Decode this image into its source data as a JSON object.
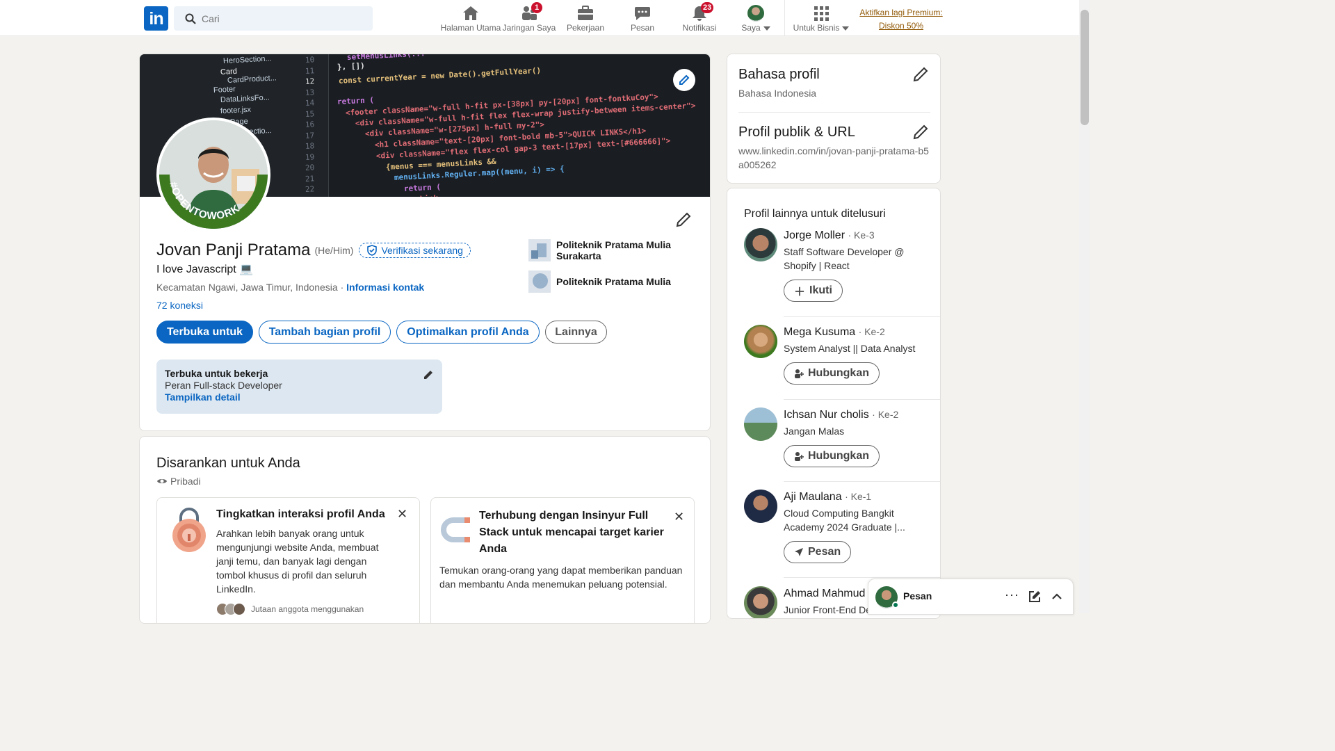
{
  "nav": {
    "search_placeholder": "Cari",
    "items": [
      {
        "label": "Halaman Utama",
        "icon": "home-icon"
      },
      {
        "label": "Jaringan Saya",
        "icon": "network-icon",
        "badge": "1"
      },
      {
        "label": "Pekerjaan",
        "icon": "briefcase-icon"
      },
      {
        "label": "Pesan",
        "icon": "message-icon"
      },
      {
        "label": "Notifikasi",
        "icon": "bell-icon",
        "badge": "23"
      },
      {
        "label": "Saya",
        "icon": "avatar"
      },
      {
        "label": "Untuk Bisnis",
        "icon": "grid-icon"
      }
    ],
    "premium_line1": "Aktifkan lagi Premium:",
    "premium_line2": "Diskon 50%"
  },
  "cover": {
    "tree": [
      "HeroSection...",
      "Card",
      "CardProduct...",
      "Footer",
      "DataLinksFo...",
      "footer.jsx",
      "Page",
      "Sectio..."
    ],
    "line_numbers": [
      "10",
      "11",
      "12",
      "13",
      "14",
      "15",
      "16",
      "17",
      "18",
      "19",
      "20",
      "21",
      "22"
    ],
    "code": [
      "setMenusLinks(...",
      "}, [])",
      "const currentYear = new Date().getFullYear()",
      "return (",
      "<footer className=\"w-full h-fit px-[38px] py-[20px] font-fontkuCoy\">",
      "<div className=\"w-full h-fit flex flex-wrap justify-between items-center\">",
      "<div className=\"w-[275px] h-full my-2\">",
      "<h1 className=\"text-[20px] font-bold mb-5\">QUICK LINKS</h1>",
      "<div className=\"flex flex-col gap-3 text-[17px] text-[#666666]\">",
      "{menus === menusLinks &&",
      "menusLinks.Reguler.map((menu, i) => {",
      "return (",
      "<Link"
    ],
    "otw_ring_text": "#OPENTOWORK"
  },
  "profile": {
    "name": "Jovan Panji Pratama",
    "pronoun": "(He/Him)",
    "verify_label": "Verifikasi sekarang",
    "headline": "I love Javascript 💻",
    "location": "Kecamatan Ngawi, Jawa Timur, Indonesia",
    "location_sep": " · ",
    "contact_info": "Informasi kontak",
    "connections": "72 koneksi",
    "buttons": [
      "Terbuka untuk",
      "Tambah bagian profil",
      "Optimalkan profil Anda",
      "Lainnya"
    ],
    "education": [
      {
        "name": "Politeknik Pratama Mulia Surakarta"
      },
      {
        "name": "Politeknik Pratama Mulia"
      }
    ],
    "open_to_work": {
      "title": "Terbuka untuk bekerja",
      "role": "Peran Full-stack Developer",
      "link": "Tampilkan detail"
    }
  },
  "suggested": {
    "title": "Disarankan untuk Anda",
    "visibility": "Pribadi",
    "cards": [
      {
        "title": "Tingkatkan interaksi profil Anda",
        "body": "Arahkan lebih banyak orang untuk mengunjungi website Anda, membuat janji temu, dan banyak lagi dengan tombol khusus di profil dan seluruh LinkedIn.",
        "footer": "Jutaan anggota menggunakan"
      },
      {
        "title": "Terhubung dengan Insinyur Full Stack untuk mencapai target karier Anda",
        "body": "Temukan orang-orang yang dapat memberikan panduan dan membantu Anda menemukan peluang potensial."
      }
    ]
  },
  "right": {
    "language_title": "Bahasa profil",
    "language_value": "Bahasa Indonesia",
    "url_title": "Profil publik & URL",
    "url_value": "www.linkedin.com/in/jovan-panji-pratama-b5a005262",
    "people_title": "Profil lainnya untuk ditelusuri",
    "people": [
      {
        "name": "Jorge Moller",
        "degree": "· Ke-3",
        "headline": "Staff Software Developer @ Shopify | React",
        "action": "Ikuti"
      },
      {
        "name": "Mega Kusuma",
        "degree": "· Ke-2",
        "headline": "System Analyst || Data Analyst",
        "action": "Hubungkan"
      },
      {
        "name": "Ichsan Nur cholis",
        "degree": "· Ke-2",
        "headline": "Jangan Malas",
        "action": "Hubungkan"
      },
      {
        "name": "Aji Maulana",
        "degree": "· Ke-1",
        "headline": "Cloud Computing Bangkit Academy 2024 Graduate |...",
        "action": "Pesan"
      },
      {
        "name": "Ahmad Mahmud",
        "degree": "",
        "headline": "Junior Front-End De",
        "action": ""
      }
    ]
  },
  "messaging": {
    "label": "Pesan"
  },
  "colors": {
    "brand": "#0a66c2",
    "premium": "#915907",
    "badge": "#cb112d",
    "open_to_work_green": "#3d7a1f"
  }
}
